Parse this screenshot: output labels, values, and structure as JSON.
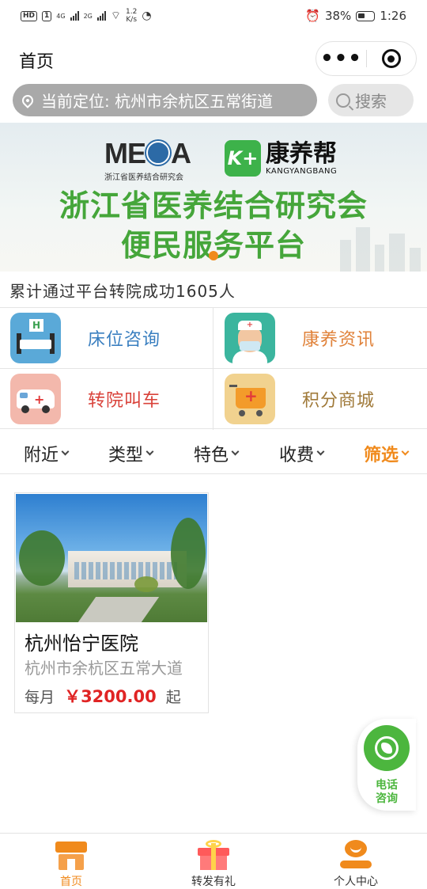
{
  "status_bar": {
    "hd": "HD",
    "sim1": "1",
    "net1": "4G",
    "net2": "2G",
    "speed_value": "1.2",
    "speed_unit": "K/s",
    "battery": "38%",
    "time": "1:26"
  },
  "navbar": {
    "title": "首页",
    "more_label": "•••"
  },
  "location": {
    "text": "当前定位: 杭州市余杭区五常街道"
  },
  "search": {
    "label": "搜索"
  },
  "banner": {
    "logo_meca": "ME   A",
    "logo_meca_sub": "浙江省医养结合研究会",
    "logo_kyb_mark": "K+",
    "logo_kyb_cn": "康养帮",
    "logo_kyb_en": "KANGYANGBANG",
    "line1": "浙江省医养结合研究会",
    "line2": "便民服务平台",
    "accent_color": "#45a63a"
  },
  "stat_line": "累计通过平台转院成功1605人",
  "services": [
    {
      "label": "床位咨询",
      "icon": "hospital-bed-icon",
      "color": "#3a7fc0"
    },
    {
      "label": "康养资讯",
      "icon": "nurse-icon",
      "color": "#e0823a"
    },
    {
      "label": "转院叫车",
      "icon": "ambulance-icon",
      "color": "#d9423a"
    },
    {
      "label": "积分商城",
      "icon": "shopping-cart-icon",
      "color": "#a07a3a"
    }
  ],
  "filters": [
    {
      "label": "附近"
    },
    {
      "label": "类型"
    },
    {
      "label": "特色"
    },
    {
      "label": "收费"
    },
    {
      "label": "筛选",
      "active": true
    }
  ],
  "hospitals": [
    {
      "name": "杭州怡宁医院",
      "address": "杭州市余杭区五常大道",
      "price_prefix": "每月",
      "currency": "￥",
      "price": "3200.00",
      "price_suffix": "起"
    }
  ],
  "phone_button": {
    "line1": "电话",
    "line2": "咨询",
    "color": "#4cb63e"
  },
  "tabbar": {
    "tabs": [
      {
        "label": "首页",
        "icon": "home-icon",
        "active": true
      },
      {
        "label": "转发有礼",
        "icon": "gift-icon",
        "active": false
      },
      {
        "label": "个人中心",
        "icon": "user-icon",
        "active": false
      }
    ],
    "accent_color": "#f08a1c"
  }
}
